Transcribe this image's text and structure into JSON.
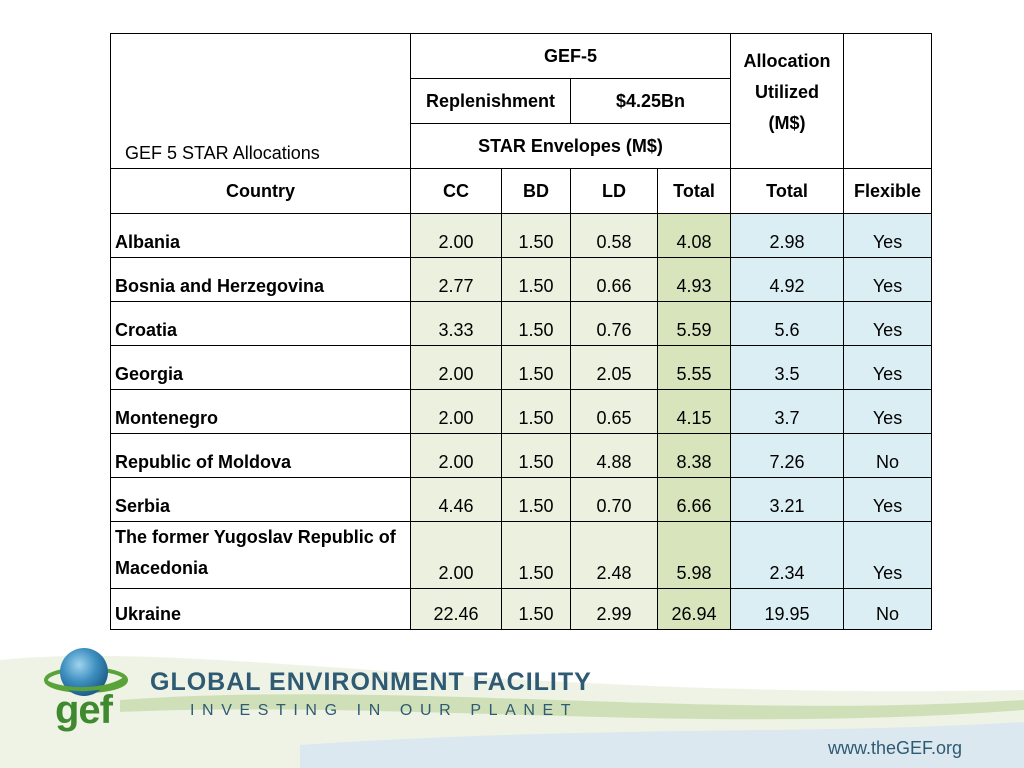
{
  "table": {
    "title": "GEF 5 STAR Allocations",
    "gef5_label": "GEF-5",
    "replenishment_label": "Replenishment",
    "replenishment_value": "$4.25Bn",
    "star_envelopes_label": "STAR Envelopes (M$)",
    "allocation_label": "Allocation Utilized (M$)",
    "columns": [
      "Country",
      "CC",
      "BD",
      "LD",
      "Total",
      "Total",
      "Flexible"
    ],
    "rows": [
      {
        "country": "Albania",
        "cc": "2.00",
        "bd": "1.50",
        "ld": "0.58",
        "total": "4.08",
        "utilized": "2.98",
        "flexible": "Yes"
      },
      {
        "country": "Bosnia and Herzegovina",
        "cc": "2.77",
        "bd": "1.50",
        "ld": "0.66",
        "total": "4.93",
        "utilized": "4.92",
        "flexible": "Yes"
      },
      {
        "country": "Croatia",
        "cc": "3.33",
        "bd": "1.50",
        "ld": "0.76",
        "total": "5.59",
        "utilized": "5.6",
        "flexible": "Yes"
      },
      {
        "country": "Georgia",
        "cc": "2.00",
        "bd": "1.50",
        "ld": "2.05",
        "total": "5.55",
        "utilized": "3.5",
        "flexible": "Yes"
      },
      {
        "country": "Montenegro",
        "cc": "2.00",
        "bd": "1.50",
        "ld": "0.65",
        "total": "4.15",
        "utilized": "3.7",
        "flexible": "Yes"
      },
      {
        "country": "Republic of Moldova",
        "cc": "2.00",
        "bd": "1.50",
        "ld": "4.88",
        "total": "8.38",
        "utilized": "7.26",
        "flexible": "No"
      },
      {
        "country": "Serbia",
        "cc": "4.46",
        "bd": "1.50",
        "ld": "0.70",
        "total": "6.66",
        "utilized": "3.21",
        "flexible": "Yes"
      },
      {
        "country": "The former Yugoslav Republic of Macedonia",
        "cc": "2.00",
        "bd": "1.50",
        "ld": "2.48",
        "total": "5.98",
        "utilized": "2.34",
        "flexible": "Yes"
      },
      {
        "country": "Ukraine",
        "cc": "22.46",
        "bd": "1.50",
        "ld": "2.99",
        "total": "26.94",
        "utilized": "19.95",
        "flexible": "No"
      }
    ]
  },
  "footer": {
    "logo_word": "gef",
    "brand_name": "GLOBAL ENVIRONMENT FACILITY",
    "tagline": "INVESTING IN OUR PLANET",
    "url": "www.theGEF.org"
  },
  "colors": {
    "green_light": "#ebf1de",
    "green_dark": "#d7e4bc",
    "blue_light": "#dbeef4",
    "brand_blue": "#2f5a73",
    "brand_green": "#3f8a2e"
  }
}
